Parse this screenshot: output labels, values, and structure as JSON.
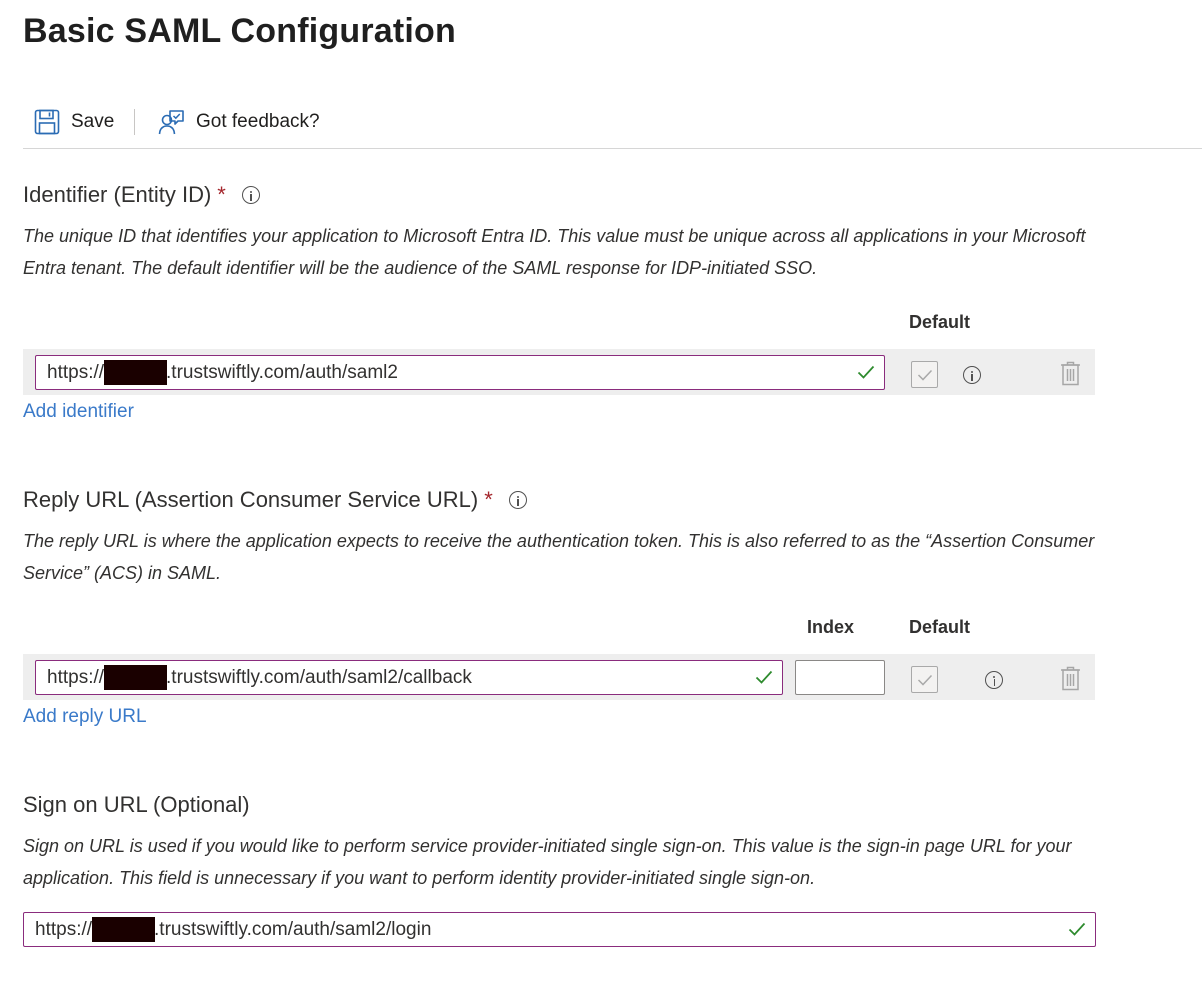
{
  "page": {
    "title": "Basic SAML Configuration"
  },
  "toolbar": {
    "save_label": "Save",
    "save_icon": "save-icon",
    "feedback_label": "Got feedback?",
    "feedback_icon": "feedback-icon"
  },
  "identifier": {
    "title": "Identifier (Entity ID)",
    "required_mark": "*",
    "description": "The unique ID that identifies your application to Microsoft Entra ID. This value must be unique across all applications in your Microsoft Entra tenant. The default identifier will be the audience of the SAML response for IDP-initiated SSO.",
    "default_header": "Default",
    "rows": [
      {
        "url_prefix": "https://",
        "url_suffix": ".trustswiftly.com/auth/saml2",
        "default_checked": true
      }
    ],
    "add_label": "Add identifier"
  },
  "reply_url": {
    "title": "Reply URL (Assertion Consumer Service URL)",
    "required_mark": "*",
    "description": "The reply URL is where the application expects to receive the authentication token. This is also referred to as the “Assertion Consumer Service” (ACS) in SAML.",
    "index_header": "Index",
    "default_header": "Default",
    "rows": [
      {
        "url_prefix": "https://",
        "url_suffix": ".trustswiftly.com/auth/saml2/callback",
        "index": "",
        "default_checked": true
      }
    ],
    "add_label": "Add reply URL"
  },
  "sign_on": {
    "title": "Sign on URL (Optional)",
    "description": "Sign on URL is used if you would like to perform service provider-initiated single sign-on. This value is the sign-in page URL for your application. This field is unnecessary if you want to perform identity provider-initiated single sign-on.",
    "url_prefix": "https://",
    "url_suffix": ".trustswiftly.com/auth/saml2/login"
  },
  "colors": {
    "input_border": "#8a2c7d",
    "valid_check": "#2e8b2e",
    "link": "#3a7ac9",
    "required": "#a4262c",
    "redaction": "#1a0000"
  }
}
